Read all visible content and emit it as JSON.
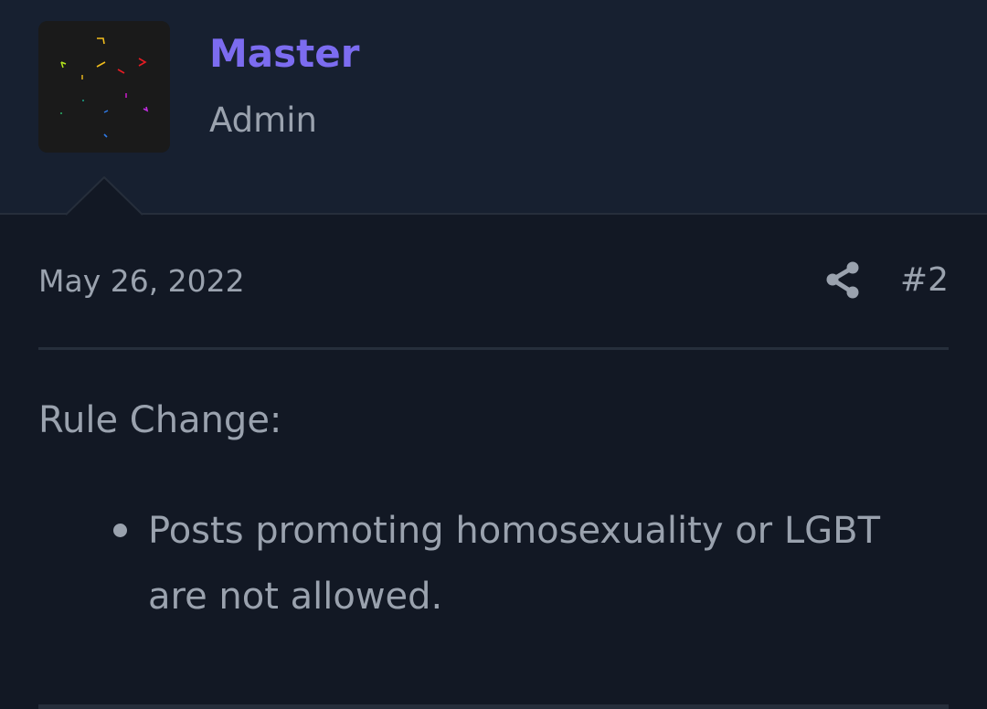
{
  "user": {
    "name": "Master",
    "title": "Admin",
    "name_color": "#7c6cf0"
  },
  "post": {
    "date": "May 26, 2022",
    "number": "#2",
    "share_icon": "share-icon",
    "heading": "Rule Change:",
    "rules": [
      "Posts promoting homosexuality or LGBT are not allowed."
    ]
  },
  "colors": {
    "background": "#121824",
    "header_background": "#172030",
    "text": "#9aa2ae"
  }
}
